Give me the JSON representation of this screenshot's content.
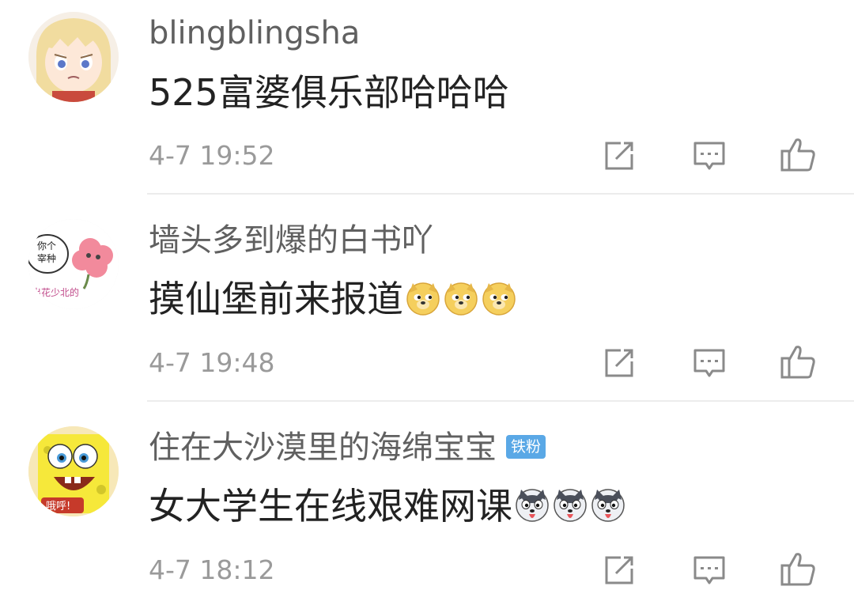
{
  "comments": [
    {
      "username": "blingblingsha",
      "badge": "",
      "content": "525富婆俱乐部哈哈哈",
      "time": "4-7 19:52",
      "avatar_icon": "anime-girl-avatar",
      "emojis": []
    },
    {
      "username": "墙头多到爆的白书吖",
      "badge": "",
      "content": "摸仙堡前来报道",
      "time": "4-7 19:48",
      "avatar_icon": "sticker-avatar",
      "avatar_text": {
        "top": "你个",
        "bottom": "宰种",
        "strip": "出花少北的"
      },
      "emojis": [
        "doge-emoji",
        "doge-emoji",
        "doge-emoji"
      ]
    },
    {
      "username": "住在大沙漠里的海绵宝宝",
      "badge": "铁粉",
      "content": "女大学生在线艰难网课",
      "time": "4-7 18:12",
      "avatar_icon": "spongebob-avatar",
      "avatar_text": {
        "caption": "哦呼!"
      },
      "emojis": [
        "husky-emoji",
        "husky-emoji",
        "husky-emoji"
      ]
    }
  ],
  "actions": [
    "repost-icon",
    "comment-icon",
    "like-icon"
  ],
  "colors": {
    "badge": "#5aa8e6",
    "username": "#606060",
    "content": "#222222",
    "time": "#9a9a9a",
    "icon": "#8a8a8a"
  }
}
